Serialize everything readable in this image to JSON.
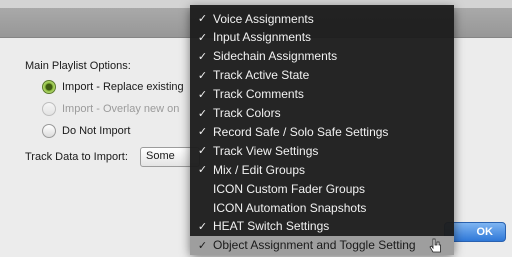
{
  "dialog": {
    "main_playlist_label": "Main Playlist Options:",
    "options": [
      {
        "label": "Import - Replace existing",
        "selected": true,
        "enabled": true
      },
      {
        "label": "Import - Overlay new on",
        "selected": false,
        "enabled": false
      },
      {
        "label": "Do Not Import",
        "selected": false,
        "enabled": true
      }
    ],
    "track_data_label": "Track Data to Import:",
    "track_data_value": "Some",
    "ok_label": "OK"
  },
  "menu": {
    "items": [
      {
        "label": "Voice Assignments",
        "checked": true
      },
      {
        "label": "Input Assignments",
        "checked": true
      },
      {
        "label": "Sidechain Assignments",
        "checked": true
      },
      {
        "label": "Track Active State",
        "checked": true
      },
      {
        "label": "Track Comments",
        "checked": true
      },
      {
        "label": "Track Colors",
        "checked": true
      },
      {
        "label": "Record Safe / Solo Safe Settings",
        "checked": true
      },
      {
        "label": "Track View Settings",
        "checked": true
      },
      {
        "label": "Mix / Edit Groups",
        "checked": true
      },
      {
        "label": "ICON Custom Fader Groups",
        "checked": false
      },
      {
        "label": "ICON Automation Snapshots",
        "checked": false
      },
      {
        "label": "HEAT Switch Settings",
        "checked": true
      },
      {
        "label": "Object Assignment and Toggle Setting",
        "checked": true,
        "highlighted": true
      }
    ],
    "check_glyph": "✓"
  },
  "colors": {
    "menu_bg": "#1c1c1c",
    "highlight": "#9e9e9e",
    "ok_button": "#2f78d8"
  }
}
